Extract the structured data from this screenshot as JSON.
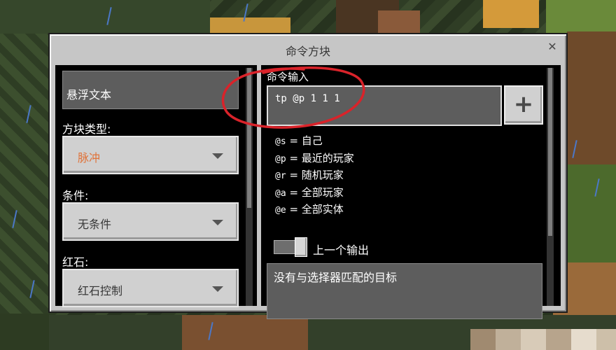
{
  "dialog": {
    "title": "命令方块",
    "close_icon": "close-icon"
  },
  "left_panel": {
    "hover_text_value": "悬浮文本",
    "block_type": {
      "label": "方块类型:",
      "value": "脉冲",
      "value_color": "#e0733a"
    },
    "condition": {
      "label": "条件:",
      "value": "无条件"
    },
    "redstone": {
      "label": "红石:",
      "value": "红石控制"
    }
  },
  "right_panel": {
    "command_input_label": "命令输入",
    "command_value": "tp @p 1 1 1",
    "add_button_icon": "plus-icon",
    "selector_help": [
      {
        "code": "@s",
        "desc": "= 自己"
      },
      {
        "code": "@p",
        "desc": "= 最近的玩家"
      },
      {
        "code": "@r",
        "desc": "= 随机玩家"
      },
      {
        "code": "@a",
        "desc": "= 全部玩家"
      },
      {
        "code": "@e",
        "desc": "= 全部实体"
      }
    ],
    "previous_output_label": "上一个输出",
    "previous_output_enabled": true,
    "output_text": "没有与选择器匹配的目标"
  },
  "colors": {
    "annotation": "#d9232a",
    "panel_bg": "#000000",
    "dialog_bg": "#c6c6c6"
  }
}
